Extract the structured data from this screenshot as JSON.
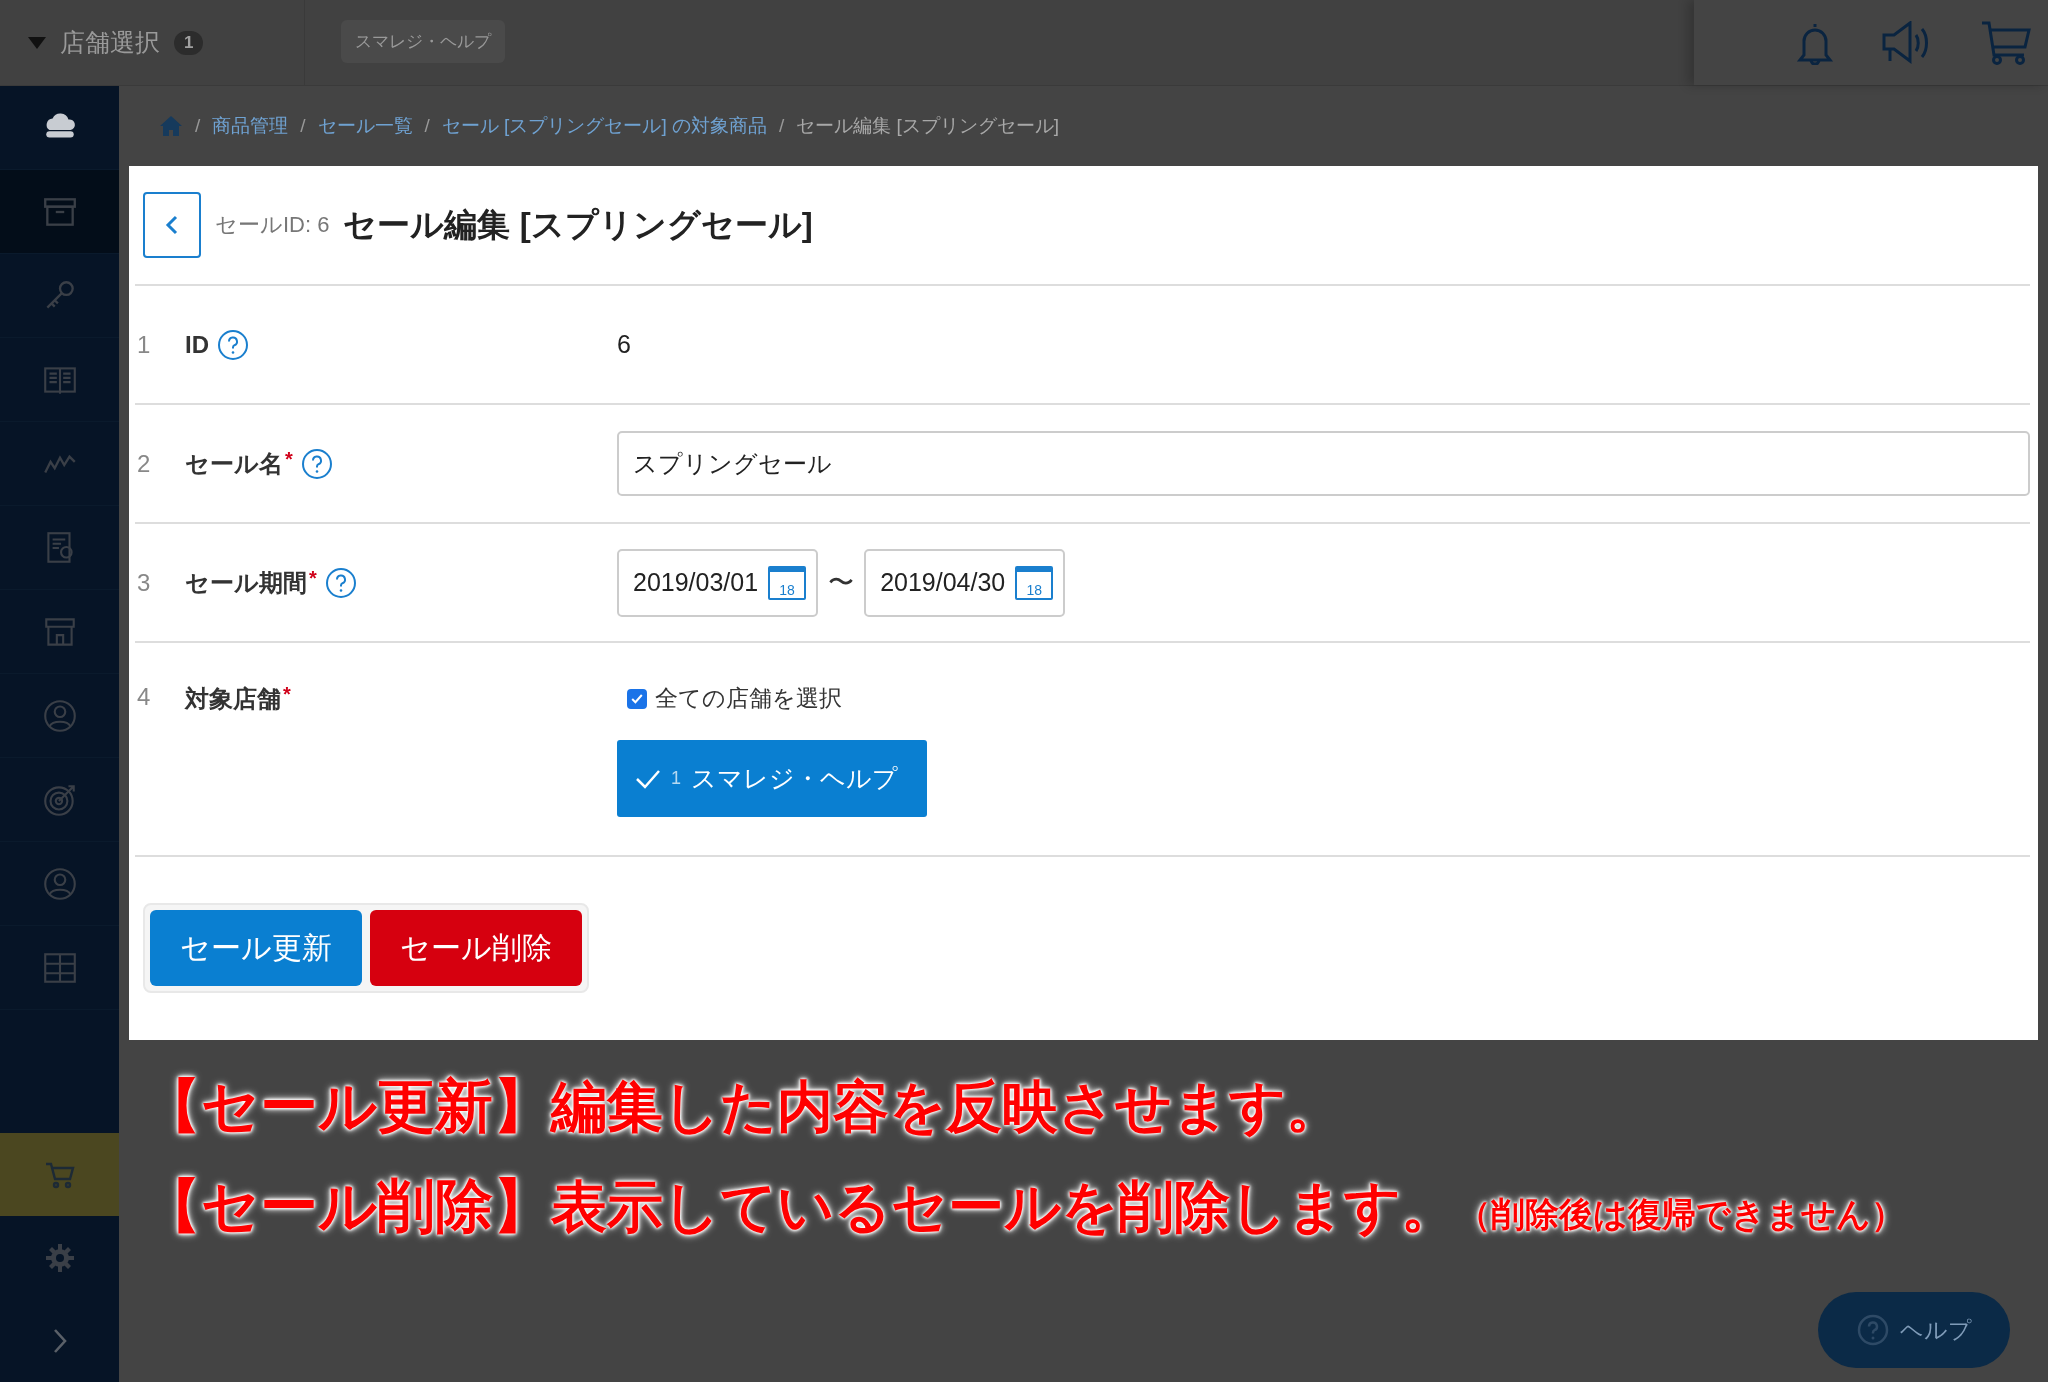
{
  "topbar": {
    "store_select": {
      "label": "店舗選択",
      "count": "1"
    },
    "store_chip": "スマレジ・ヘルプ"
  },
  "sidebar": {
    "items": [
      {
        "selected": false
      },
      {
        "selected": true
      },
      {
        "selected": false
      },
      {
        "selected": false
      },
      {
        "selected": false
      },
      {
        "selected": false
      },
      {
        "selected": false
      },
      {
        "selected": false
      },
      {
        "selected": false
      },
      {
        "selected": false
      },
      {
        "selected": false
      }
    ],
    "bottom_items": [
      {
        "selected": true
      },
      {
        "selected": false
      },
      {
        "selected": false
      }
    ]
  },
  "breadcrumb": {
    "separator": "/",
    "items": [
      {
        "label": "商品管理",
        "current": false
      },
      {
        "label": "セール一覧",
        "current": false
      },
      {
        "label": "セール [スプリングセール] の対象商品",
        "current": false
      },
      {
        "label": "セール編集 [スプリングセール]",
        "current": true
      }
    ]
  },
  "form": {
    "id_label": "セールID: 6",
    "title": "セール編集 [スプリングセール]",
    "rows": [
      {
        "number": "1",
        "label": "ID",
        "help": true,
        "kind": "text",
        "value": "6"
      },
      {
        "number": "2",
        "label": "セール名",
        "required_mark": "*",
        "help": true,
        "kind": "input",
        "value": "スプリングセール"
      },
      {
        "number": "3",
        "label": "セール期間",
        "required_mark": "*",
        "help": true,
        "kind": "date_range",
        "start": "2019/03/01",
        "end": "2019/04/30",
        "start_calendar_day": "18",
        "end_calendar_day": "18",
        "separator": "〜"
      },
      {
        "number": "4",
        "label": "対象店舗",
        "required_mark": "*",
        "help": false,
        "kind": "stores",
        "select_all": {
          "label": "全ての店舗を選択",
          "checked": true
        },
        "stores": [
          {
            "number": "1",
            "name": "スマレジ・ヘルプ",
            "selected": true
          }
        ]
      }
    ],
    "buttons": [
      {
        "label": "セール更新",
        "kind": "primary"
      },
      {
        "label": "セール削除",
        "kind": "danger"
      }
    ]
  },
  "annotations": [
    {
      "label": "【セール更新】",
      "text": "編集した内容を反映させます。"
    },
    {
      "label": "【セール削除】",
      "text": "表示しているセールを削除します。",
      "note": "（削除後は復帰できません）"
    }
  ],
  "help_button": {
    "label": "ヘルプ"
  }
}
